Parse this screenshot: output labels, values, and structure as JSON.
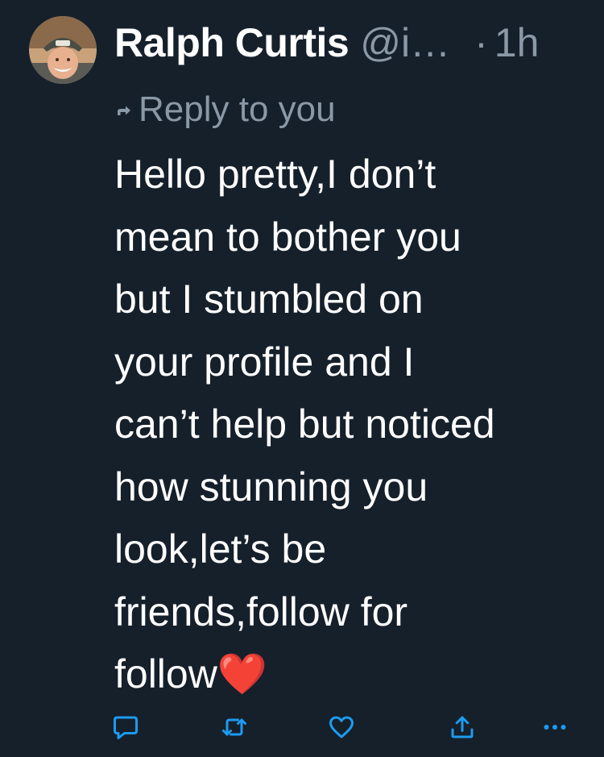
{
  "tweet": {
    "author": {
      "display_name": "Ralph Curtis",
      "handle": "@i…",
      "avatar_icon": "avatar-photo"
    },
    "separator": "·",
    "timestamp": "1h",
    "reply_label": "Reply to you",
    "text": "Hello pretty,I don’t\nmean to bother you\nbut I stumbled on\nyour profile and I\ncan’t help but noticed\nhow stunning you\nlook,let’s be\nfriends,follow for\nfollow❤️"
  },
  "actions": [
    {
      "icon": "reply-icon",
      "label": "Reply"
    },
    {
      "icon": "retweet-icon",
      "label": "Retweet"
    },
    {
      "icon": "heart-icon",
      "label": "Like"
    },
    {
      "icon": "share-icon",
      "label": "Share"
    },
    {
      "icon": "more-icon",
      "label": "More"
    }
  ],
  "colors": {
    "background": "#15202b",
    "primary_text": "#ffffff",
    "secondary_text": "#8b98a5",
    "action_icon": "#1d9bf0",
    "heart_emoji": "#e0222e"
  }
}
